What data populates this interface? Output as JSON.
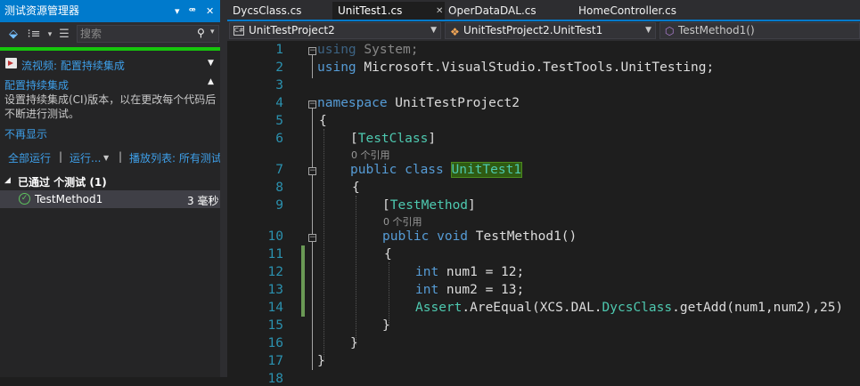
{
  "explorer": {
    "title": "测试资源管理器",
    "pin_glyph": "▾",
    "autohide_glyph": "ᵖ",
    "close_glyph": "✕",
    "search_placeholder": "搜索",
    "video_link": "流视频: 配置持续集成",
    "ci_heading": "配置持续集成",
    "ci_desc_line1": "设置持续集成(CI)版本，以在更改每个代码后",
    "ci_desc_line2": "不断进行测试。",
    "dismiss_link": "不再显示",
    "run_all": "全部运行",
    "run_menu": "运行...",
    "playlist": "播放列表: 所有测试",
    "sep": "|",
    "group_header": "已通过 个测试 (1)",
    "test_name": "TestMethod1",
    "test_duration": "3 毫秒"
  },
  "tabs": [
    {
      "label": "DycsClass.cs",
      "active": false
    },
    {
      "label": "UnitTest1.cs",
      "active": true,
      "close": "✕"
    },
    {
      "label": "OperDataDAL.cs",
      "active": false
    },
    {
      "label": "HomeController.cs",
      "active": false
    }
  ],
  "navbar": {
    "project": "UnitTestProject2",
    "class": "UnitTestProject2.UnitTest1",
    "member": "TestMethod1()"
  },
  "editor": {
    "line_numbers": [
      "1",
      "2",
      "3",
      "4",
      "5",
      "6",
      "7",
      "8",
      "9",
      "10",
      "11",
      "12",
      "13",
      "14",
      "15",
      "16",
      "17",
      "18"
    ],
    "reference_hint": "0 个引用",
    "lines": {
      "l1_kw": "using",
      "l1_rest": " System;",
      "l2_kw": "using",
      "l2_rest": " Microsoft.VisualStudio.TestTools.UnitTesting;",
      "l4_kw": "namespace",
      "l4_rest": " UnitTestProject2",
      "l5": "{",
      "l6_open": "[",
      "l6_attr": "TestClass",
      "l6_close": "]",
      "l7_kw1": "public",
      "l7_kw2": " class ",
      "l7_name": "UnitTest1",
      "l8": "{",
      "l9_open": "[",
      "l9_attr": "TestMethod",
      "l9_close": "]",
      "l10_kw1": "public",
      "l10_kw2": " void",
      "l10_rest": " TestMethod1()",
      "l11": "{",
      "l12_kw": "int",
      "l12_rest": " num1 = 12;",
      "l13_kw": "int",
      "l13_rest": " num2 = 13;",
      "l14_ty": "Assert",
      "l14_a": ".AreEqual(XCS.DAL.",
      "l14_ty2": "DycsClass",
      "l14_b": ".getAdd(num1,num2),25)",
      "l15": "}",
      "l16": "}",
      "l17": "}"
    }
  }
}
